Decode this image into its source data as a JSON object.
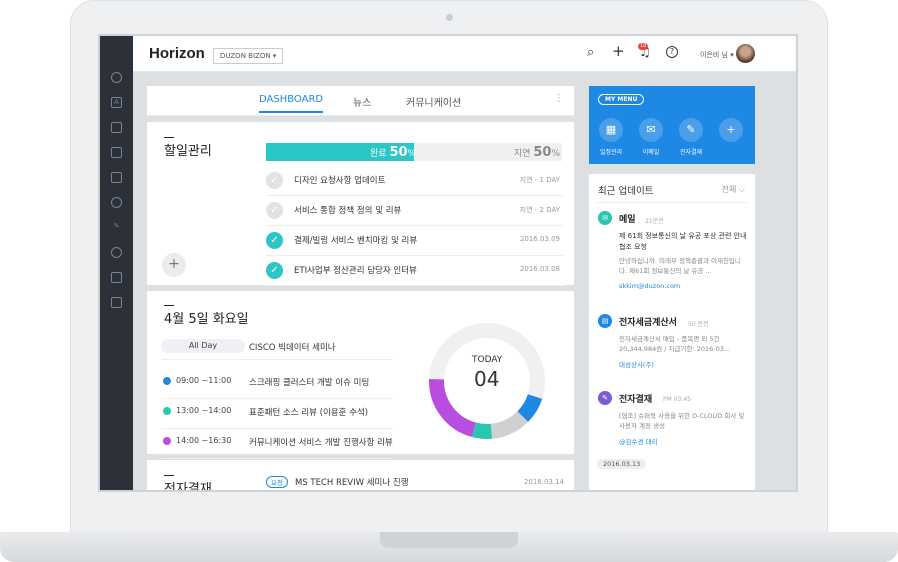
{
  "app": {
    "logo": "Horizon",
    "company": "DUZON BIZON ▾",
    "user": "이은비 님 ▾",
    "notif_count": "10"
  },
  "tabs": [
    "DASHBOARD",
    "뉴스",
    "커뮤니케이션"
  ],
  "todo": {
    "title": "할일관리",
    "done_label": "완료",
    "done_pct": "50",
    "delay_label": "지연",
    "delay_pct": "50",
    "pct_sign": "%",
    "done_fraction": 0.5,
    "tasks": [
      {
        "title": "디자인 요청사항 업데이트",
        "date": "지연 - 1 DAY",
        "checked": false
      },
      {
        "title": "서비스 통합 정책 정의 및 리뷰",
        "date": "지연 - 2 DAY",
        "checked": false
      },
      {
        "title": "결제/빌링 서비스 벤치마킹 및 리뷰",
        "date": "2016.03.09",
        "checked": true
      },
      {
        "title": "ETI사업부 정산관리 담당자 인터뷰",
        "date": "2016.03.08",
        "checked": true
      }
    ]
  },
  "schedule": {
    "title": "4월 5일 화요일",
    "allday_label": "All Day",
    "allday_event": "CISCO 빅데이터 세미나",
    "events": [
      {
        "time": "09:00 ~11:00",
        "name": "스크래핑 클러스터 개발 이슈 미팅",
        "color": "#1e88e5"
      },
      {
        "time": "13:00 ~14:00",
        "name": "표준패턴 소스 리뷰 (이용훈 수석)",
        "color": "#2bc6b0"
      },
      {
        "time": "14:00 ~16:30",
        "name": "커뮤니케이션 서비스 개발 진행사항 리뷰",
        "color": "#b84de0"
      }
    ],
    "today_label": "TODAY",
    "today_num": "04"
  },
  "approval": {
    "title": "전자결재",
    "status": "요청",
    "item": "MS TECH REVIW 세미나 진행",
    "date": "2016.03.14"
  },
  "mymenu": {
    "label": "MY MENU",
    "items": [
      "일정관리",
      "이메일",
      "전자결재"
    ]
  },
  "updates": {
    "title": "최근 업데이트",
    "filter": "전체 ⌵",
    "items": [
      {
        "type": "메일",
        "time": "21분전",
        "body": "제 61회 정보통신의 날 유공 포상 관련 안내 협조 요청",
        "snippet": "안녕하십니까. 미래부 정책총괄과 이재헌입니다. 제61회 정보통신의 날 유공 ...",
        "link": "skkim@duzon.com",
        "color": "#2bc6b0"
      },
      {
        "type": "전자세금계산서",
        "time": "50 분전",
        "body": "",
        "snippet": "전자세금계산서 매입 - 품목명 외 5건 20,344,984원 / 지급기한: 2016-03...",
        "link": "대성상사(주)",
        "color": "#1e88e5"
      },
      {
        "type": "전자결재",
        "time": "PM 03:45",
        "body": "",
        "snippet": "[협조] 슈퍼북 사용을 위한 D-CLOUD 회사 및 사용자 계정 생성",
        "link": "@김수경 대리",
        "color": "#7b5cd6"
      }
    ],
    "date_chip": "2016.03.13"
  }
}
